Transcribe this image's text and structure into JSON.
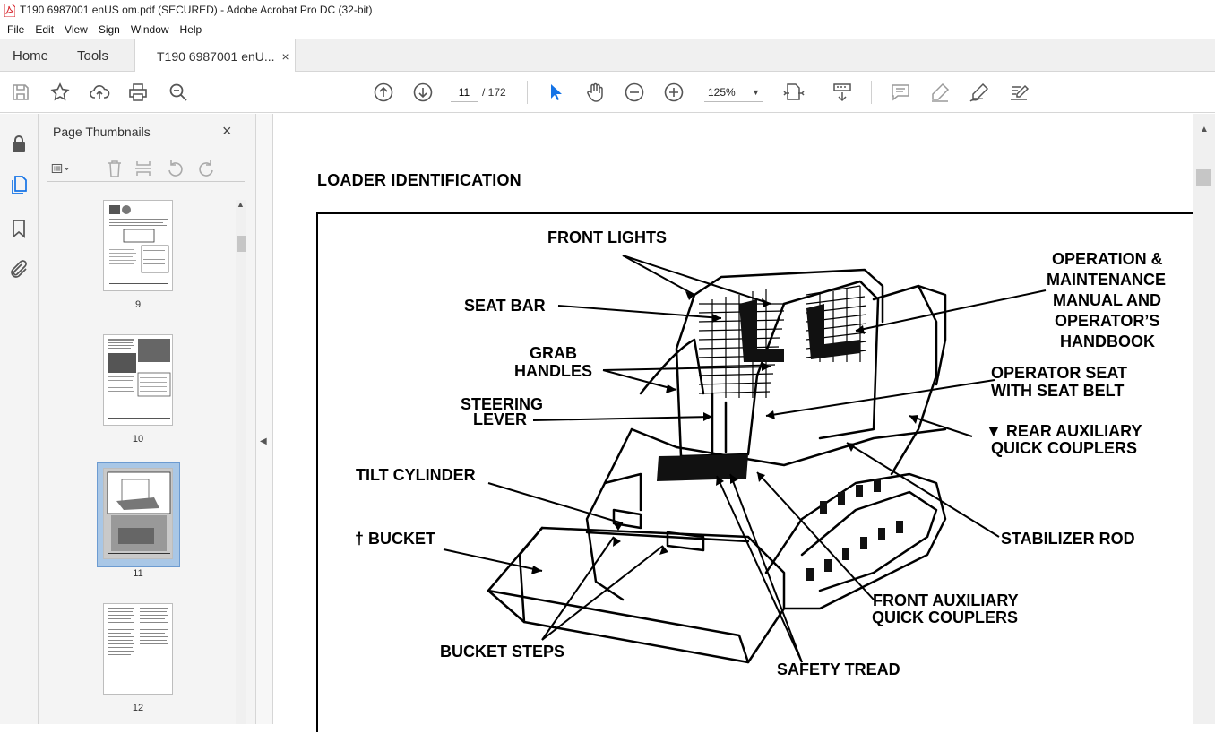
{
  "window": {
    "title": "T190 6987001 enUS om.pdf (SECURED) - Adobe Acrobat Pro DC (32-bit)"
  },
  "menu": [
    "File",
    "Edit",
    "View",
    "Sign",
    "Window",
    "Help"
  ],
  "tabs": {
    "home": "Home",
    "tools": "Tools",
    "document": "T190 6987001 enU...",
    "close": "×"
  },
  "toolbar": {
    "page_current": "11",
    "page_total": "/ 172",
    "zoom": "125%"
  },
  "thumbnails": {
    "title": "Page Thumbnails",
    "close": "×",
    "pages": [
      {
        "label": "9"
      },
      {
        "label": "10"
      },
      {
        "label": "11",
        "selected": true
      },
      {
        "label": "12"
      }
    ]
  },
  "document": {
    "heading": "LOADER IDENTIFICATION",
    "figure_labels": {
      "front_lights": "FRONT LIGHTS",
      "seat_bar": "SEAT BAR",
      "grab_handles_1": "GRAB",
      "grab_handles_2": "HANDLES",
      "steering_lever_1": "STEERING",
      "steering_lever_2": "LEVER",
      "tilt_cylinder": "TILT CYLINDER",
      "bucket": "† BUCKET",
      "bucket_steps": "BUCKET STEPS",
      "safety_tread": "SAFETY TREAD",
      "front_aux_1": "FRONT AUXILIARY",
      "front_aux_2": "QUICK COUPLERS",
      "stabilizer_rod": "STABILIZER ROD",
      "rear_aux_1": "▼   REAR AUXILIARY",
      "rear_aux_2": "QUICK COUPLERS",
      "operator_seat_1": "OPERATOR SEAT",
      "operator_seat_2": "WITH SEAT BELT",
      "manual_1": "OPERATION &",
      "manual_2": "MAINTENANCE",
      "manual_3": "MANUAL AND",
      "manual_4": "OPERATOR’S",
      "manual_5": "HANDBOOK"
    }
  },
  "colors": {
    "accent": "#1473e6",
    "selection": "#a9c7e6"
  }
}
